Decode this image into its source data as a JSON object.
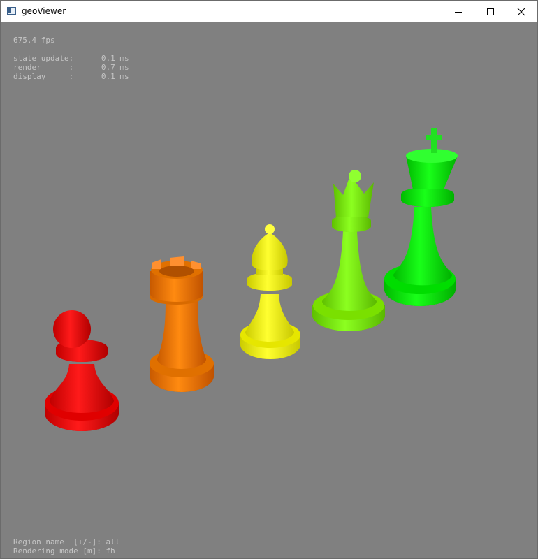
{
  "window": {
    "title": "geoViewer"
  },
  "hud": {
    "fps": "675.4 fps",
    "stats": [
      {
        "label": "state update:",
        "value": "0.1 ms"
      },
      {
        "label": "render      :",
        "value": "0.7 ms"
      },
      {
        "label": "display     :",
        "value": "0.1 ms"
      }
    ],
    "status": [
      {
        "label": "Region name  [+/-]:",
        "value": "all"
      },
      {
        "label": "Rendering mode [m]:",
        "value": "fh"
      }
    ]
  },
  "scene": {
    "background": "#808080",
    "pieces": [
      {
        "name": "pawn",
        "color": "#ff0000"
      },
      {
        "name": "rook",
        "color": "#ff7f00"
      },
      {
        "name": "bishop",
        "color": "#ffff00"
      },
      {
        "name": "queen",
        "color": "#80ff00"
      },
      {
        "name": "king",
        "color": "#00ff00"
      }
    ]
  },
  "icons": {
    "app": "app-window-icon",
    "minimize": "minimize-icon",
    "maximize": "maximize-icon",
    "close": "close-icon"
  }
}
